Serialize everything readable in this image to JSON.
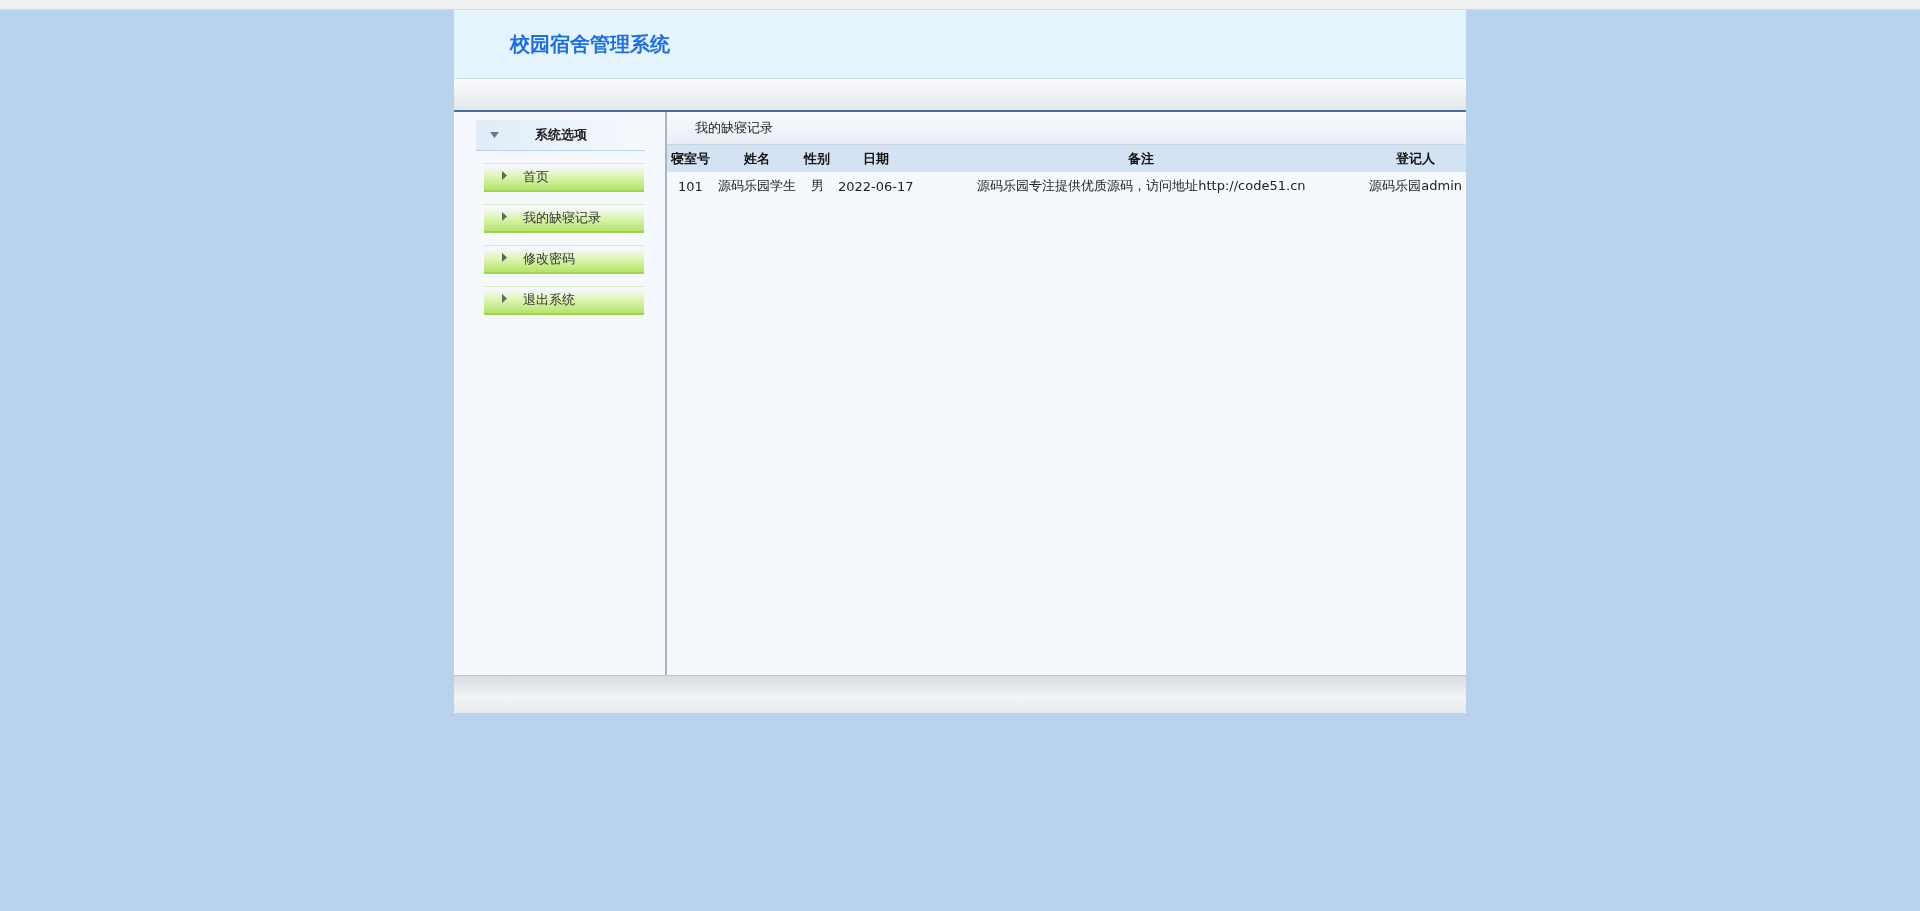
{
  "header": {
    "title": "校园宿舍管理系统"
  },
  "sidebar": {
    "title": "系统选项",
    "expanded": true,
    "items": [
      {
        "label": "首页"
      },
      {
        "label": "我的缺寝记录"
      },
      {
        "label": "修改密码"
      },
      {
        "label": "退出系统"
      }
    ]
  },
  "content": {
    "title": "我的缺寝记录",
    "table": {
      "columns": [
        "寝室号",
        "姓名",
        "性别",
        "日期",
        "备注",
        "登记人"
      ],
      "rows": [
        [
          "101",
          "源码乐园学生",
          "男",
          "2022-06-17",
          "源码乐园专注提供优质源码，访问地址http://code51.cn",
          "源码乐园admin"
        ]
      ]
    }
  }
}
